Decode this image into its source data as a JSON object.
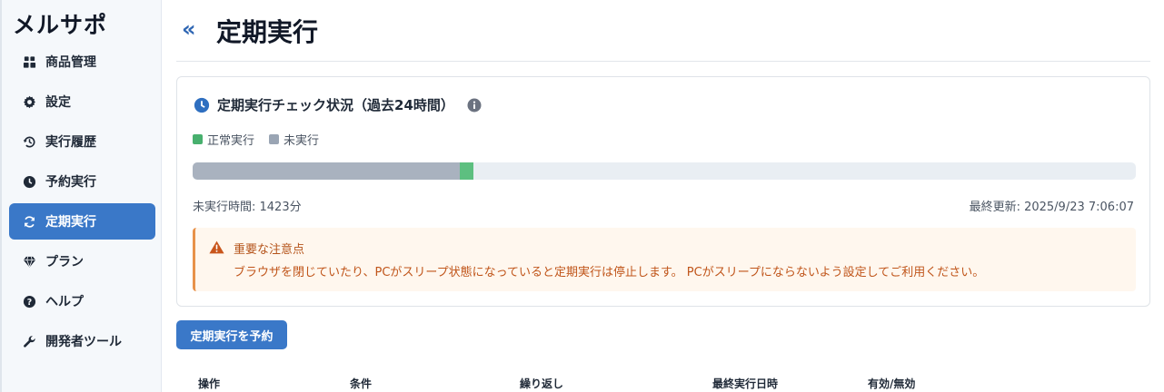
{
  "app": {
    "title": "メルサポ"
  },
  "sidebar": {
    "items": [
      {
        "label": "商品管理",
        "icon": "boxes-icon",
        "active": false
      },
      {
        "label": "設定",
        "icon": "gear-icon",
        "active": false
      },
      {
        "label": "実行履歴",
        "icon": "history-icon",
        "active": false
      },
      {
        "label": "予約実行",
        "icon": "clock-icon",
        "active": false
      },
      {
        "label": "定期実行",
        "icon": "refresh-icon",
        "active": true
      },
      {
        "label": "プラン",
        "icon": "gem-icon",
        "active": false
      },
      {
        "label": "ヘルプ",
        "icon": "question-icon",
        "active": false
      },
      {
        "label": "開発者ツール",
        "icon": "wrench-icon",
        "active": false
      }
    ]
  },
  "header": {
    "collapse_symbol": "«",
    "title": "定期実行"
  },
  "status_card": {
    "title": "定期実行チェック状況（過去24時間）",
    "legend": [
      {
        "label": "正常実行",
        "color": "#48b06e"
      },
      {
        "label": "未実行",
        "color": "#9aa5b4"
      }
    ],
    "timeline": {
      "segments": [
        {
          "status": "未実行",
          "start": 0.0,
          "end": 0.2835,
          "color": "#a9b2bf"
        },
        {
          "status": "正常実行",
          "start": 0.2835,
          "end": 0.2975,
          "color": "#5dbf80"
        }
      ],
      "track_color": "#e9eef3"
    },
    "unexecuted_time": "未実行時間: 1423分",
    "last_updated": "最終更新: 2025/9/23 7:06:07",
    "notice": {
      "title": "重要な注意点",
      "body": "ブラウザを閉じていたり、PCがスリープ状態になっていると定期実行は停止します。 PCがスリープにならないよう設定してご利用ください。"
    }
  },
  "actions": {
    "schedule_button": "定期実行を予約"
  },
  "table": {
    "columns": [
      "操作",
      "条件",
      "繰り返し",
      "最終実行日時",
      "有効/無効"
    ]
  },
  "colors": {
    "accent": "#3a78c8",
    "warning": "#e8924a"
  }
}
